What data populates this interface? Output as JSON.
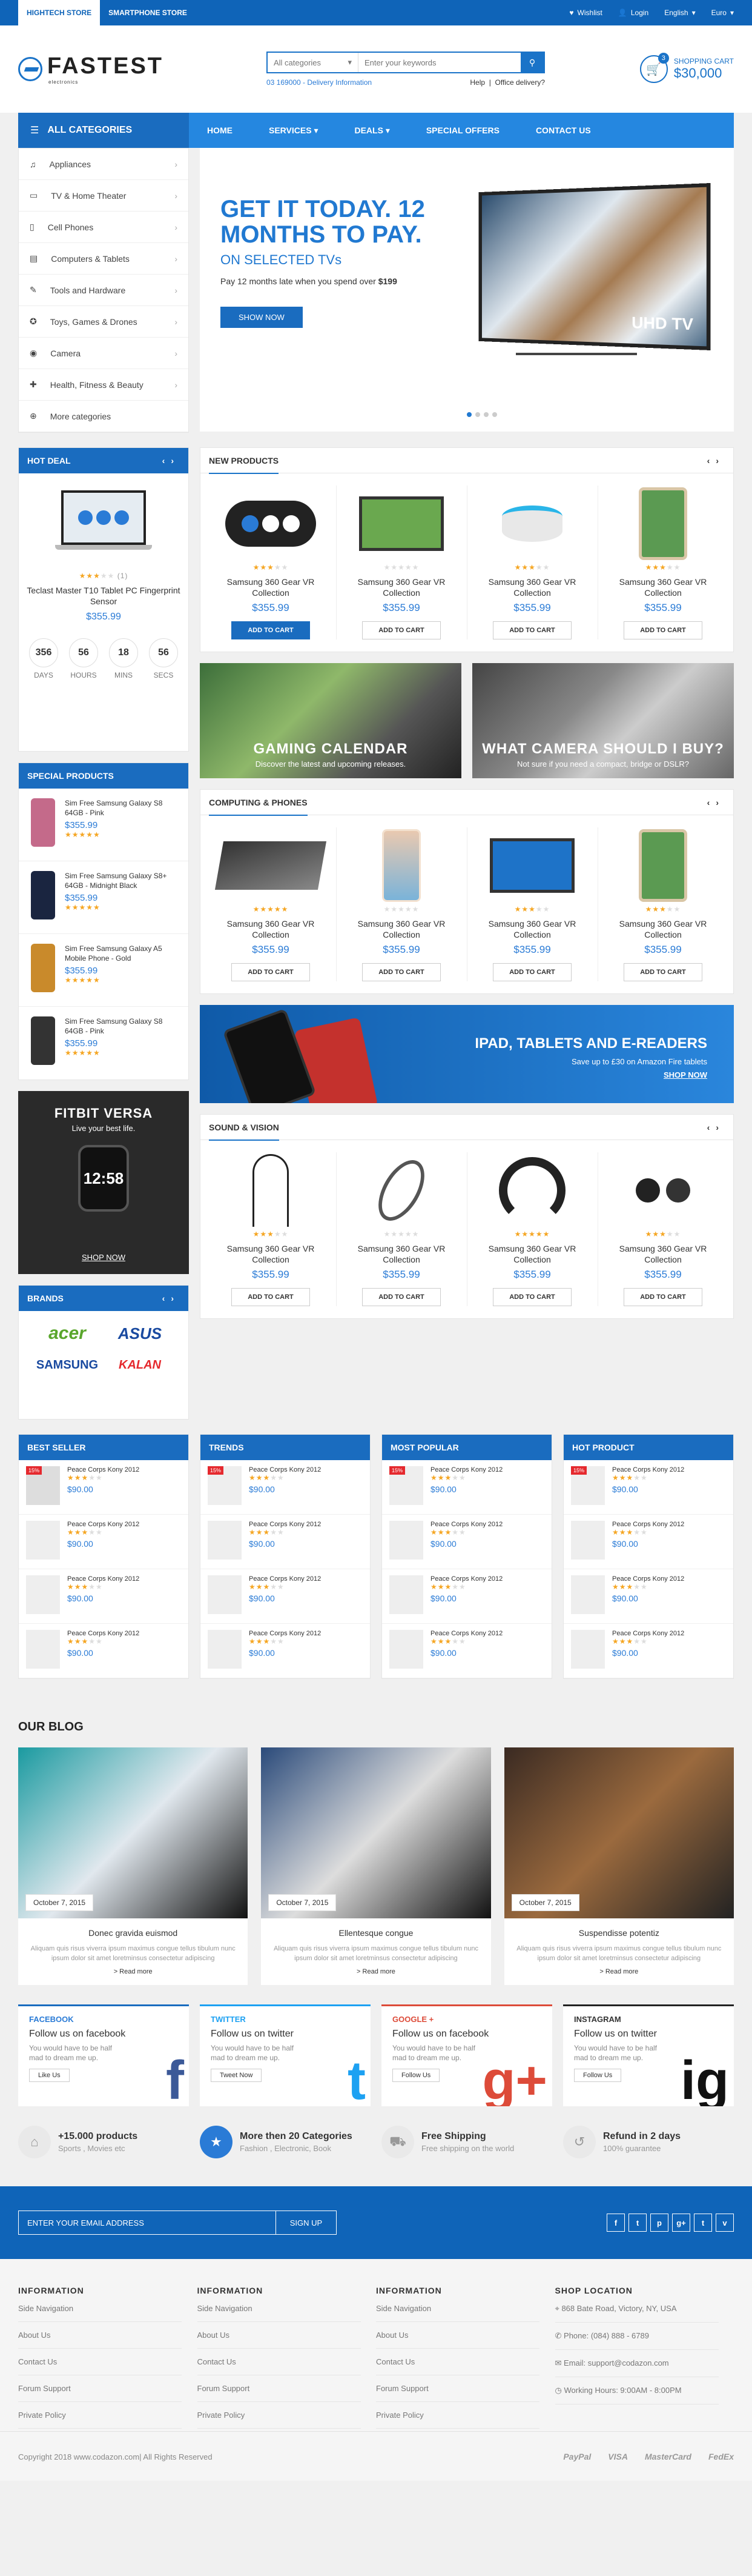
{
  "topbar": {
    "tabs": [
      "HIGHTECH STORE",
      "SMARTPHONE STORE"
    ],
    "wishlist": "Wishlist",
    "login": "Login",
    "language": "English",
    "currency": "Euro"
  },
  "header": {
    "logo": "FASTEST",
    "logo_sub": "electronics",
    "search": {
      "category": "All categories",
      "placeholder": "Enter your keywords"
    },
    "phone": "03 169000 - Delivery Information",
    "help": "Help",
    "office": "Office delivery?",
    "cart": {
      "count": "3",
      "label": "SHOPPING CART",
      "total": "$30,000"
    }
  },
  "nav": {
    "all_categories": "ALL CATEGORIES",
    "items": [
      "HOME",
      "SERVICES",
      "DEALS",
      "SPECIAL OFFERS",
      "CONTACT US"
    ]
  },
  "sidebar_categories": [
    "Appliances",
    "TV & Home Theater",
    "Cell Phones",
    "Computers & Tablets",
    "Tools and Hardware",
    "Toys, Games & Drones",
    "Camera",
    "Health, Fitness & Beauty",
    "More categories"
  ],
  "hero": {
    "title": "GET IT TODAY. 12 MONTHS TO PAY.",
    "subtitle": "ON SELECTED TVs",
    "desc": "Pay 12 months late when you spend over",
    "desc_amount": "$199",
    "button": "SHOW NOW",
    "tv_label": "UHD TV"
  },
  "hot_deal": {
    "title": "HOT DEAL",
    "name": "Teclast Master T10 Tablet PC Fingerprint Sensor",
    "price": "$355.99",
    "reviews": "(1)",
    "timer": [
      {
        "v": "356",
        "l": "DAYS"
      },
      {
        "v": "56",
        "l": "HOURS"
      },
      {
        "v": "18",
        "l": "MINS"
      },
      {
        "v": "56",
        "l": "SECS"
      }
    ]
  },
  "new_products": {
    "title": "NEW PRODUCTS",
    "items": [
      {
        "name": "Samsung 360 Gear VR Collection",
        "price": "$355.99",
        "btn": "ADD TO CART"
      },
      {
        "name": "Samsung 360 Gear VR Collection",
        "price": "$355.99",
        "btn": "ADD TO CART"
      },
      {
        "name": "Samsung 360 Gear VR Collection",
        "price": "$355.99",
        "btn": "ADD TO CART"
      },
      {
        "name": "Samsung 360 Gear VR Collection",
        "price": "$355.99",
        "btn": "ADD TO CART"
      }
    ]
  },
  "banners": [
    {
      "title": "GAMING CALENDAR",
      "sub": "Discover the latest and upcoming releases."
    },
    {
      "title": "WHAT CAMERA SHOULD I BUY?",
      "sub": "Not sure if you need a compact, bridge or DSLR?"
    }
  ],
  "computing": {
    "title": "COMPUTING & PHONES",
    "items": [
      {
        "name": "Samsung 360 Gear VR Collection",
        "price": "$355.99",
        "btn": "ADD TO CART"
      },
      {
        "name": "Samsung 360 Gear VR Collection",
        "price": "$355.99",
        "btn": "ADD TO CART"
      },
      {
        "name": "Samsung 360 Gear VR Collection",
        "price": "$355.99",
        "btn": "ADD TO CART"
      },
      {
        "name": "Samsung 360 Gear VR Collection",
        "price": "$355.99",
        "btn": "ADD TO CART"
      }
    ]
  },
  "special_products": {
    "title": "SPECIAL PRODUCTS",
    "items": [
      {
        "name": "Sim Free Samsung Galaxy S8 64GB - Pink",
        "price": "$355.99"
      },
      {
        "name": "Sim Free Samsung Galaxy S8+ 64GB - Midnight Black",
        "price": "$355.99"
      },
      {
        "name": "Sim Free Samsung Galaxy A5 Mobile Phone - Gold",
        "price": "$355.99"
      },
      {
        "name": "Sim Free Samsung Galaxy S8 64GB - Pink",
        "price": "$355.99"
      }
    ]
  },
  "fitbit": {
    "title": "FITBIT VERSA",
    "sub": "Live your best life.",
    "time": "12:58",
    "shop": "SHOP NOW"
  },
  "ipad_banner": {
    "title": "IPAD, TABLETS AND E-READERS",
    "sub": "Save up to £30 on Amazon Fire tablets",
    "shop": "SHOP NOW"
  },
  "sound": {
    "title": "SOUND & VISION",
    "items": [
      {
        "name": "Samsung 360 Gear VR Collection",
        "price": "$355.99",
        "btn": "ADD TO CART"
      },
      {
        "name": "Samsung 360 Gear VR Collection",
        "price": "$355.99",
        "btn": "ADD TO CART"
      },
      {
        "name": "Samsung 360 Gear VR Collection",
        "price": "$355.99",
        "btn": "ADD TO CART"
      },
      {
        "name": "Samsung 360 Gear VR Collection",
        "price": "$355.99",
        "btn": "ADD TO CART"
      }
    ]
  },
  "brands": {
    "title": "BRANDS",
    "items": [
      "acer",
      "ASUS",
      "SAMSUNG",
      "KALAN"
    ]
  },
  "lists": [
    {
      "title": "BEST SELLER",
      "items": [
        {
          "name": "Peace Corps Kony 2012",
          "price": "$90.00",
          "badge": "15%"
        },
        {
          "name": "Peace Corps Kony 2012",
          "price": "$90.00",
          "badge": ""
        },
        {
          "name": "Peace Corps Kony 2012",
          "price": "$90.00",
          "badge": ""
        },
        {
          "name": "Peace Corps Kony 2012",
          "price": "$90.00",
          "badge": ""
        }
      ]
    },
    {
      "title": "TRENDS",
      "items": [
        {
          "name": "Peace Corps Kony 2012",
          "price": "$90.00",
          "badge": "15%"
        },
        {
          "name": "Peace Corps Kony 2012",
          "price": "$90.00",
          "badge": ""
        },
        {
          "name": "Peace Corps Kony 2012",
          "price": "$90.00",
          "badge": ""
        },
        {
          "name": "Peace Corps Kony 2012",
          "price": "$90.00",
          "badge": ""
        }
      ]
    },
    {
      "title": "MOST POPULAR",
      "items": [
        {
          "name": "Peace Corps Kony 2012",
          "price": "$90.00",
          "badge": "15%"
        },
        {
          "name": "Peace Corps Kony 2012",
          "price": "$90.00",
          "badge": ""
        },
        {
          "name": "Peace Corps Kony 2012",
          "price": "$90.00",
          "badge": ""
        },
        {
          "name": "Peace Corps Kony 2012",
          "price": "$90.00",
          "badge": ""
        }
      ]
    },
    {
      "title": "HOT PRODUCT",
      "items": [
        {
          "name": "Peace Corps Kony 2012",
          "price": "$90.00",
          "badge": "15%"
        },
        {
          "name": "Peace Corps Kony 2012",
          "price": "$90.00",
          "badge": ""
        },
        {
          "name": "Peace Corps Kony 2012",
          "price": "$90.00",
          "badge": ""
        },
        {
          "name": "Peace Corps Kony 2012",
          "price": "$90.00",
          "badge": ""
        }
      ]
    }
  ],
  "blog": {
    "title": "OUR BLOG",
    "posts": [
      {
        "date": "October 7, 2015",
        "title": "Donec gravida euismod",
        "excerpt": "Aliquam quis risus viverra ipsum maximus congue tellus tibulum nunc ipsum dolor sit amet loretminsus consectetur adipiscing",
        "more": "> Read more"
      },
      {
        "date": "October 7, 2015",
        "title": "Ellentesque congue",
        "excerpt": "Aliquam quis risus viverra ipsum maximus congue tellus tibulum nunc ipsum dolor sit amet loretminsus consectetur adipiscing",
        "more": "> Read more"
      },
      {
        "date": "October 7, 2015",
        "title": "Suspendisse potentiz",
        "excerpt": "Aliquam quis risus viverra ipsum maximus congue tellus tibulum nunc ipsum dolor sit amet loretminsus consectetur adipiscing",
        "more": "> Read more"
      }
    ]
  },
  "socials": [
    {
      "title": "FACEBOOK",
      "follow": "Follow us on facebook",
      "desc": "You would have to be half mad to dream me up.",
      "btn": "Like Us",
      "icon": "f"
    },
    {
      "title": "TWITTER",
      "follow": "Follow us on twitter",
      "desc": "You would have to be half mad to dream me up.",
      "btn": "Tweet Now",
      "icon": "t"
    },
    {
      "title": "GOOGLE +",
      "follow": "Follow us on facebook",
      "desc": "You would have to be half mad to dream me up.",
      "btn": "Follow Us",
      "icon": "g+"
    },
    {
      "title": "INSTAGRAM",
      "follow": "Follow us on twitter",
      "desc": "You would have to be half mad to dream me up.",
      "btn": "Follow Us",
      "icon": "ig"
    }
  ],
  "features": [
    {
      "t1": "+15.000 products",
      "t2": "Sports , Movies etc"
    },
    {
      "t1": "More then 20 Categories",
      "t2": "Fashion , Electronic, Book"
    },
    {
      "t1": "Free Shipping",
      "t2": "Free shipping on the world"
    },
    {
      "t1": "Refund in 2 days",
      "t2": "100% guarantee"
    }
  ],
  "newsletter": {
    "placeholder": "ENTER YOUR EMAIL ADDRESS",
    "button": "SIGN UP",
    "icons": [
      "f",
      "t",
      "p",
      "g+",
      "t",
      "v"
    ]
  },
  "footer": {
    "cols": [
      {
        "title": "INFORMATION",
        "links": [
          "Side Navigation",
          "About Us",
          "Contact Us",
          "Forum Support",
          "Private Policy"
        ]
      },
      {
        "title": "INFORMATION",
        "links": [
          "Side Navigation",
          "About Us",
          "Contact Us",
          "Forum Support",
          "Private Policy"
        ]
      },
      {
        "title": "INFORMATION",
        "links": [
          "Side Navigation",
          "About Us",
          "Contact Us",
          "Forum Support",
          "Private Policy"
        ]
      },
      {
        "title": "SHOP LOCATION",
        "links": [
          "868 Bate Road, Victory, NY, USA",
          "Phone: (084) 888 - 6789",
          "Email: support@codazon.com",
          "Working Hours: 9:00AM - 8:00PM"
        ]
      }
    ],
    "copyright": "Copyright 2018  www.codazon.com|  All Rights Reserved",
    "payments": [
      "PayPal",
      "VISA",
      "MasterCard",
      "FedEx"
    ]
  }
}
